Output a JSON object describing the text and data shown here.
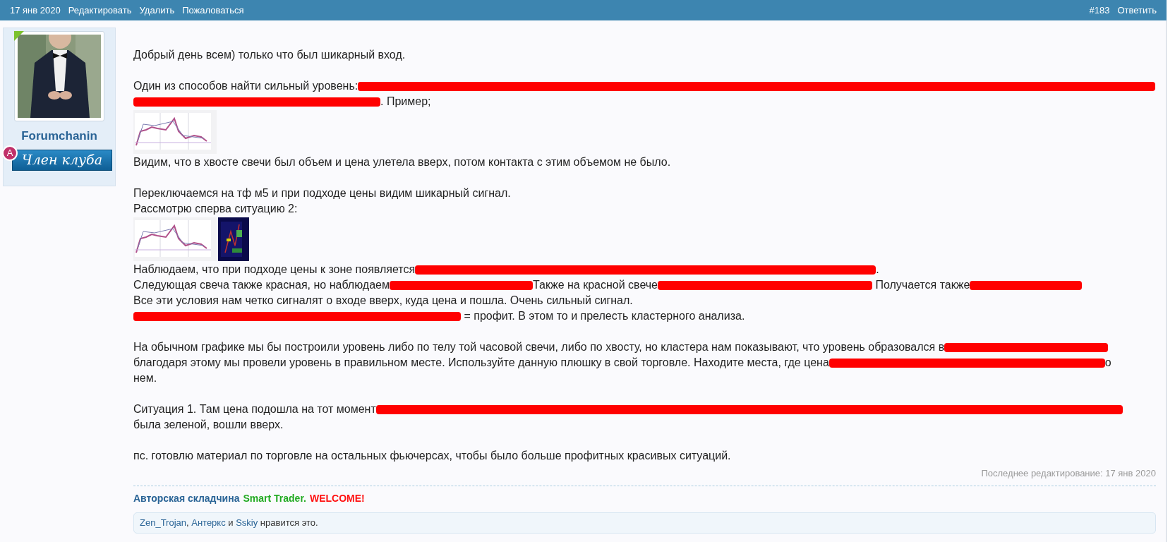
{
  "header": {
    "left": [
      "17 янв 2020",
      "Редактировать",
      "Удалить",
      "Пожаловаться"
    ],
    "right": [
      "#183",
      "Ответить"
    ]
  },
  "author": {
    "name": "Forumchanin",
    "badge_letter": "A",
    "badge": "Член клуба"
  },
  "body": [
    {
      "kind": "line",
      "segments": [
        {
          "kind": "text",
          "text": "Добрый день всем) только что был шикарный вход."
        }
      ]
    },
    {
      "kind": "gap"
    },
    {
      "kind": "line",
      "segments": [
        {
          "kind": "text",
          "text": "Один из способов найти сильный уровень:"
        },
        {
          "kind": "redaction"
        }
      ]
    },
    {
      "kind": "line",
      "segments": [
        {
          "kind": "redaction"
        },
        {
          "kind": "text",
          "text": ". Пример;"
        }
      ]
    },
    {
      "kind": "thumbnails",
      "images": [
        {
          "kind": "light"
        }
      ]
    },
    {
      "kind": "line",
      "segments": [
        {
          "kind": "text",
          "text": "Видим, что в хвосте свечи был объем и цена улетела вверх, потом контакта с этим объемом не было."
        }
      ]
    },
    {
      "kind": "gap"
    },
    {
      "kind": "line",
      "segments": [
        {
          "kind": "text",
          "text": "Переключаемся на тф м5 и при подходе цены видим шикарный сигнал."
        }
      ]
    },
    {
      "kind": "line",
      "segments": [
        {
          "kind": "text",
          "text": "Рассмотрю сперва ситуацию 2:"
        }
      ]
    },
    {
      "kind": "thumbnails",
      "images": [
        {
          "kind": "light"
        },
        {
          "kind": "dark"
        }
      ]
    },
    {
      "kind": "line",
      "segments": [
        {
          "kind": "text",
          "text": "Наблюдаем, что при подходе цены к зоне появляется"
        },
        {
          "kind": "redaction"
        },
        {
          "kind": "text",
          "text": "."
        }
      ]
    },
    {
      "kind": "line",
      "segments": [
        {
          "kind": "text",
          "text": "Следующая свеча также красная, но наблюдаем"
        },
        {
          "kind": "redaction"
        },
        {
          "kind": "text",
          "text": "Также на красной свече"
        },
        {
          "kind": "redaction"
        },
        {
          "kind": "text",
          "text": " Получается также"
        },
        {
          "kind": "redaction"
        }
      ]
    },
    {
      "kind": "line",
      "segments": [
        {
          "kind": "text",
          "text": "Все эти условия нам четко сигналят о входе вверх, куда цена и пошла. Очень сильный сигнал."
        }
      ]
    },
    {
      "kind": "line",
      "segments": [
        {
          "kind": "redaction"
        },
        {
          "kind": "text",
          "text": " = профит. В этом то и прелесть кластерного анализа."
        }
      ]
    },
    {
      "kind": "gap"
    },
    {
      "kind": "line",
      "segments": [
        {
          "kind": "text",
          "text": "На обычном графике мы бы построили уровень либо по телу той часовой свечи, либо по хвосту, но кластера нам показывают, что уровень образовался в"
        },
        {
          "kind": "redaction"
        }
      ]
    },
    {
      "kind": "line",
      "segments": [
        {
          "kind": "text",
          "text": "благодаря этому мы провели уровень в правильном месте. Используйте данную плюшку в свой торговле. Находите места, где цена"
        },
        {
          "kind": "redaction"
        },
        {
          "kind": "text",
          "text": "о"
        }
      ]
    },
    {
      "kind": "line",
      "segments": [
        {
          "kind": "text",
          "text": "нем."
        }
      ]
    },
    {
      "kind": "gap"
    },
    {
      "kind": "line",
      "segments": [
        {
          "kind": "text",
          "text": "Ситуация 1. Там цена подошла на тот момент"
        },
        {
          "kind": "redaction"
        }
      ]
    },
    {
      "kind": "line",
      "segments": [
        {
          "kind": "text",
          "text": "была зеленой, вошли вверх."
        }
      ]
    },
    {
      "kind": "gap"
    },
    {
      "kind": "line",
      "segments": [
        {
          "kind": "text",
          "text": "пс. готовлю материал по торговле на остальных фьючерсах, чтобы было больше профитных красивых ситуаций."
        }
      ]
    }
  ],
  "edited": "Последнее редактирование: 17 янв 2020",
  "signature": [
    {
      "text": "Авторская складчина",
      "color": "#2a6496"
    },
    {
      "text": "Smart Trader.",
      "color": "#22aa22"
    },
    {
      "text": "WELCOME!",
      "color": "#ff1111"
    }
  ],
  "likes": [
    {
      "kind": "link",
      "text": "Zen_Trojan"
    },
    {
      "kind": "text",
      "text": ", "
    },
    {
      "kind": "link",
      "text": "Антеркс"
    },
    {
      "kind": "text",
      "text": " и "
    },
    {
      "kind": "link",
      "text": "Sskiy"
    },
    {
      "kind": "text",
      "text": " нравится это."
    }
  ]
}
